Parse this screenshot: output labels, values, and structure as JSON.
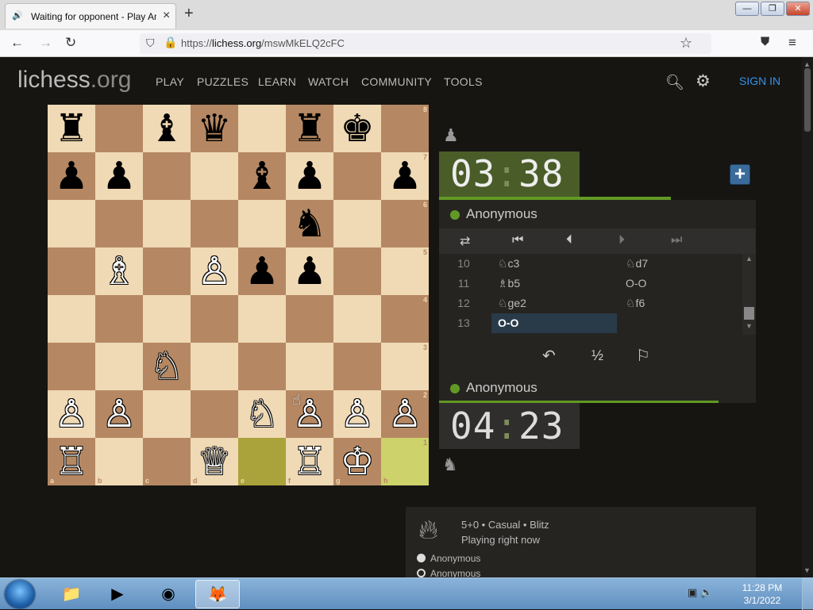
{
  "browser": {
    "tab_title": "Waiting for opponent - Play Anonymous",
    "tab_audio_icon": "speaker-icon",
    "new_tab": "+",
    "url_host": "lichess.org",
    "url_prefix": "https://",
    "url_path": "/mswMkELQ2cFC"
  },
  "site": {
    "logo_main": "lichess",
    "logo_domain": ".org",
    "menu": [
      "PLAY",
      "PUZZLES",
      "LEARN",
      "WATCH",
      "COMMUNITY",
      "TOOLS"
    ],
    "sign_in": "SIGN IN"
  },
  "board": {
    "ranks": [
      "8",
      "7",
      "6",
      "5",
      "4",
      "3",
      "2",
      "1"
    ],
    "files": [
      "a",
      "b",
      "c",
      "d",
      "e",
      "f",
      "g",
      "h"
    ],
    "pieces": [
      {
        "sq": "a8",
        "p": "♜",
        "c": "b"
      },
      {
        "sq": "c8",
        "p": "♝",
        "c": "b"
      },
      {
        "sq": "d8",
        "p": "♛",
        "c": "b"
      },
      {
        "sq": "f8",
        "p": "♜",
        "c": "b"
      },
      {
        "sq": "g8",
        "p": "♚",
        "c": "b"
      },
      {
        "sq": "a7",
        "p": "♟",
        "c": "b"
      },
      {
        "sq": "b7",
        "p": "♟",
        "c": "b"
      },
      {
        "sq": "e7",
        "p": "♝",
        "c": "b"
      },
      {
        "sq": "f7",
        "p": "♟",
        "c": "b"
      },
      {
        "sq": "h7",
        "p": "♟",
        "c": "b"
      },
      {
        "sq": "f6",
        "p": "♞",
        "c": "b"
      },
      {
        "sq": "b5",
        "p": "♗",
        "c": "w"
      },
      {
        "sq": "d5",
        "p": "♙",
        "c": "w"
      },
      {
        "sq": "e5",
        "p": "♟",
        "c": "b"
      },
      {
        "sq": "f5",
        "p": "♟",
        "c": "b"
      },
      {
        "sq": "c3",
        "p": "♘",
        "c": "w"
      },
      {
        "sq": "a2",
        "p": "♙",
        "c": "w"
      },
      {
        "sq": "b2",
        "p": "♙",
        "c": "w"
      },
      {
        "sq": "e2",
        "p": "♘",
        "c": "w"
      },
      {
        "sq": "f2",
        "p": "♙",
        "c": "w"
      },
      {
        "sq": "g2",
        "p": "♙",
        "c": "w"
      },
      {
        "sq": "h2",
        "p": "♙",
        "c": "w"
      },
      {
        "sq": "a1",
        "p": "♖",
        "c": "w"
      },
      {
        "sq": "d1",
        "p": "♕",
        "c": "w"
      },
      {
        "sq": "f1",
        "p": "♖",
        "c": "w"
      },
      {
        "sq": "g1",
        "p": "♔",
        "c": "w"
      }
    ],
    "last_move": [
      "e1",
      "h1"
    ]
  },
  "game": {
    "top_player": "Anonymous",
    "top_clock_min": "03",
    "top_clock_sec": "38",
    "bottom_player": "Anonymous",
    "bottom_clock_min": "04",
    "bottom_clock_sec": "23",
    "moves": [
      {
        "n": "10",
        "w": "♘c3",
        "b": "♘d7"
      },
      {
        "n": "11",
        "w": "♗b5",
        "b": "O-O"
      },
      {
        "n": "12",
        "w": "♘ge2",
        "b": "♘f6"
      },
      {
        "n": "13",
        "w": "O-O",
        "b": ""
      }
    ],
    "draw_label": "½",
    "meta": "5+0 • Casual • Blitz",
    "status": "Playing right now",
    "players": [
      "Anonymous",
      "Anonymous"
    ]
  },
  "taskbar": {
    "time": "11:28 PM",
    "date": "3/1/2022"
  },
  "colors": {
    "light_square": "#f0d9b5",
    "dark_square": "#b58863",
    "accent": "#629924",
    "link": "#3692e7"
  }
}
